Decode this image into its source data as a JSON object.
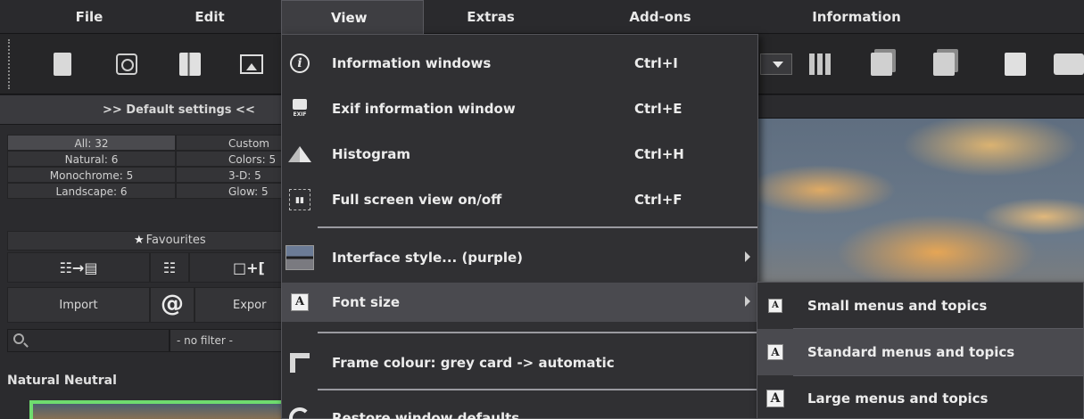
{
  "menubar": {
    "items": [
      {
        "label": "File"
      },
      {
        "label": "Edit"
      },
      {
        "label": "View"
      },
      {
        "label": "Extras"
      },
      {
        "label": "Add-ons"
      },
      {
        "label": "Information"
      }
    ]
  },
  "toolbar": {
    "icons": [
      "new-document-icon",
      "history-icon",
      "book-icon",
      "gallery-icon",
      "dropdown-icon",
      "layout-icon",
      "pages-icon",
      "export-icon",
      "save-icon",
      "filmstrip-icon"
    ]
  },
  "left_panel": {
    "default_settings": ">> Default settings <<",
    "categories": [
      {
        "left": "All: 32",
        "right": "Custom"
      },
      {
        "left": "Natural: 6",
        "right": "Colors: 5"
      },
      {
        "left": "Monochrome: 5",
        "right": "3-D: 5"
      },
      {
        "left": "Landscape: 6",
        "right": "Glow: 5"
      }
    ],
    "favourites": "Favourites",
    "import_label": "Import",
    "at_label": "@",
    "export_label": "Expor",
    "filter_value": "- no filter -",
    "preset_title": "Natural Neutral",
    "icon_row": [
      "☷→▤",
      "☷",
      "□+["
    ]
  },
  "view_menu": {
    "title": "View",
    "items": [
      {
        "label": "Information windows",
        "shortcut": "Ctrl+I",
        "icon": "info-icon"
      },
      {
        "label": "Exif information window",
        "shortcut": "Ctrl+E",
        "icon": "exif-camera-icon",
        "icon_text": "EXIF"
      },
      {
        "label": "Histogram",
        "shortcut": "Ctrl+H",
        "icon": "histogram-icon"
      },
      {
        "label": "Full screen view on/off",
        "shortcut": "Ctrl+F",
        "icon": "fullscreen-icon"
      },
      {
        "label": "Interface style... (purple)",
        "shortcut": "",
        "icon": "interface-style-icon"
      },
      {
        "label": "Font size",
        "shortcut": "",
        "icon": "font-size-icon"
      },
      {
        "label": "Frame colour: grey card -> automatic",
        "shortcut": "",
        "icon": "frame-colour-icon"
      },
      {
        "label": "Restore window defaults",
        "shortcut": "",
        "icon": "restore-icon"
      }
    ]
  },
  "font_submenu": {
    "items": [
      {
        "label": "Small menus and topics"
      },
      {
        "label": "Standard menus and topics"
      },
      {
        "label": "Large menus and topics"
      }
    ],
    "highlighted_index": 1
  },
  "colors": {
    "accent_green": "#6fdc6f",
    "menu_bg": "#303033",
    "highlight_bg": "#4a4a4f"
  }
}
